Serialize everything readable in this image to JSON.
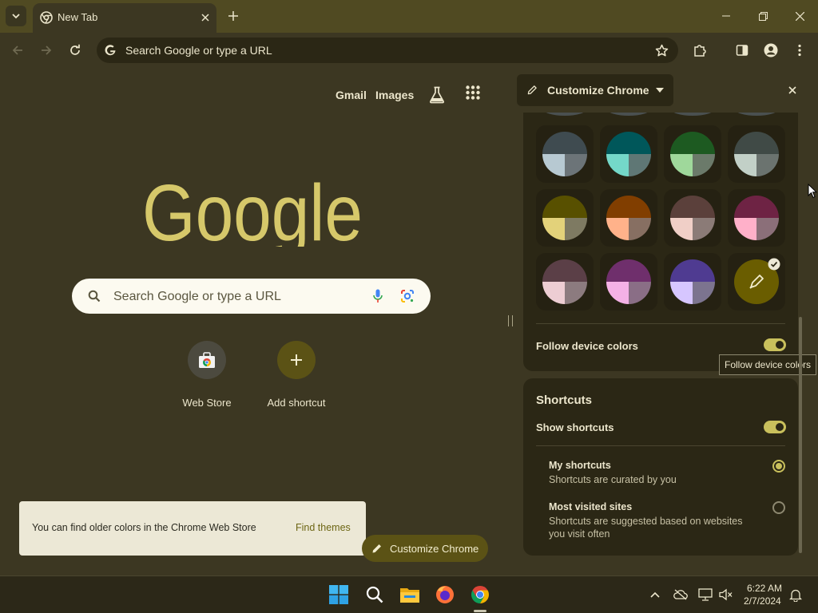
{
  "browser": {
    "tab": {
      "title": "New Tab"
    },
    "omnibox": {
      "placeholder": "Search Google or type a URL"
    }
  },
  "ntp": {
    "header_links": {
      "gmail": "Gmail",
      "images": "Images"
    },
    "logo_text": "Google",
    "search_placeholder": "Search Google or type a URL",
    "shortcuts": [
      {
        "label": "Web Store"
      },
      {
        "label": "Add shortcut"
      }
    ],
    "notice": {
      "text": "You can find older colors in the Chrome Web Store",
      "link": "Find themes"
    },
    "customize_button": "Customize Chrome"
  },
  "side_panel": {
    "title": "Customize Chrome",
    "colors": {
      "swatches": [
        {
          "name": "grey",
          "top": "#3f4b50",
          "left": "#b7c9d2",
          "right": "#6c7478"
        },
        {
          "name": "teal",
          "top": "#00575a",
          "left": "#74d8c9",
          "right": "#5f7775"
        },
        {
          "name": "green",
          "top": "#1d5a21",
          "left": "#9fd89b",
          "right": "#6b7a6a"
        },
        {
          "name": "sage",
          "top": "#404a46",
          "left": "#c2d0c7",
          "right": "#6b736f"
        },
        {
          "name": "olive",
          "top": "#585000",
          "left": "#e3d27a",
          "right": "#7e7a62"
        },
        {
          "name": "orange",
          "top": "#813e00",
          "left": "#ffb28a",
          "right": "#876f62"
        },
        {
          "name": "taupe",
          "top": "#5b403b",
          "left": "#f0cfc7",
          "right": "#8b7b77"
        },
        {
          "name": "rose",
          "top": "#6e2344",
          "left": "#ffb0c9",
          "right": "#8b6f79"
        },
        {
          "name": "mauve",
          "top": "#5b3f47",
          "left": "#edcdd3",
          "right": "#8c7b7f"
        },
        {
          "name": "violet",
          "top": "#6f2f6c",
          "left": "#f4b1e6",
          "right": "#8a6e86"
        },
        {
          "name": "indigo",
          "top": "#4f3b91",
          "left": "#d6c6ff",
          "right": "#7c748f"
        },
        {
          "name": "custom",
          "color": "#6a5d00",
          "selected": true
        }
      ]
    },
    "follow_device_colors": {
      "label": "Follow device colors",
      "on": true,
      "tooltip": "Follow device colors"
    },
    "shortcuts": {
      "title": "Shortcuts",
      "show_label": "Show shortcuts",
      "show_on": true,
      "options": [
        {
          "title": "My shortcuts",
          "subtitle": "Shortcuts are curated by you",
          "selected": true
        },
        {
          "title": "Most visited sites",
          "subtitle": "Shortcuts are suggested based on websites you visit often",
          "selected": false
        }
      ]
    }
  },
  "taskbar": {
    "time": "6:22 AM",
    "date": "2/7/2024"
  }
}
